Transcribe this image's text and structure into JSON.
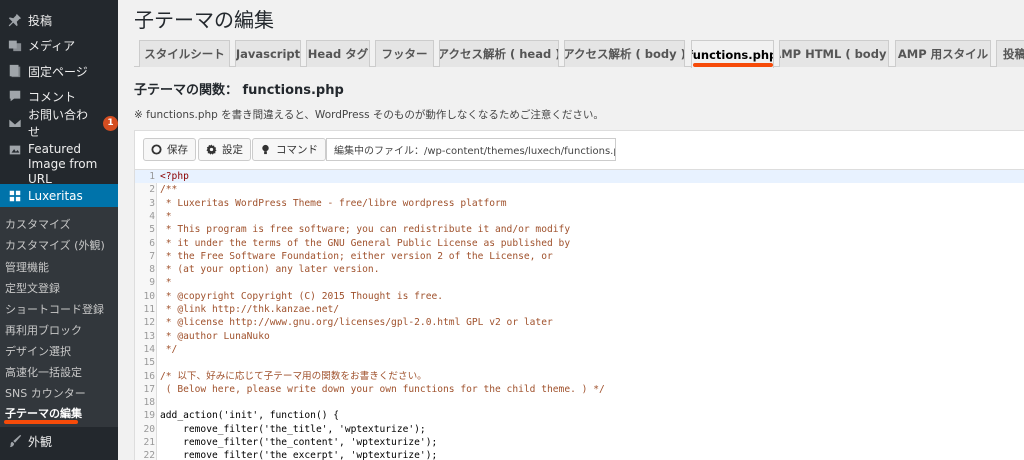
{
  "sidebar": {
    "items": [
      {
        "label": "投稿",
        "icon": "pin-icon"
      },
      {
        "label": "メディア",
        "icon": "media-icon"
      },
      {
        "label": "固定ページ",
        "icon": "page-icon"
      },
      {
        "label": "コメント",
        "icon": "comment-icon"
      },
      {
        "label": "お問い合わせ",
        "icon": "mail-icon",
        "badge": "1"
      },
      {
        "label": "Featured Image from URL",
        "icon": "image-icon"
      },
      {
        "label": "Luxeritas",
        "icon": "theme-icon",
        "active": true
      },
      {
        "label": "外観",
        "icon": "brush-icon"
      }
    ],
    "submenu": [
      "カスタマイズ",
      "カスタマイズ (外観)",
      "管理機能",
      "定型文登録",
      "ショートコード登録",
      "再利用ブロック",
      "デザイン選択",
      "高速化一括設定",
      "SNS カウンター",
      "子テーマの編集"
    ],
    "current_submenu_index": 9
  },
  "page": {
    "title": "子テーマの編集",
    "tabs": [
      "スタイルシート",
      "Javascript",
      "Head タグ",
      "フッター",
      "アクセス解析 ( head )",
      "アクセス解析 ( body )",
      "functions.php",
      "AMP HTML ( body )",
      "AMP 用スタイル",
      "投稿"
    ],
    "active_tab_index": 6,
    "section_title": "子テーマの関数： functions.php",
    "notice": "※ functions.php を書き間違えると、WordPress そのものが動作しなくなるためご注意ください。"
  },
  "toolbar": {
    "save_label": "保存",
    "settings_label": "設定",
    "command_label": "コマンド",
    "file_path": "編集中のファイル：/wp-content/themes/luxech/functions.php"
  },
  "code": {
    "lines": [
      {
        "n": "1",
        "t": "<?php",
        "k": "php"
      },
      {
        "n": "2",
        "t": "/**",
        "k": "comment"
      },
      {
        "n": "3",
        "t": " * Luxeritas WordPress Theme - free/libre wordpress platform",
        "k": "comment"
      },
      {
        "n": "4",
        "t": " *",
        "k": "comment"
      },
      {
        "n": "5",
        "t": " * This program is free software; you can redistribute it and/or modify",
        "k": "comment"
      },
      {
        "n": "6",
        "t": " * it under the terms of the GNU General Public License as published by",
        "k": "comment"
      },
      {
        "n": "7",
        "t": " * the Free Software Foundation; either version 2 of the License, or",
        "k": "comment"
      },
      {
        "n": "8",
        "t": " * (at your option) any later version.",
        "k": "comment"
      },
      {
        "n": "9",
        "t": " *",
        "k": "comment"
      },
      {
        "n": "10",
        "t": " * @copyright Copyright (C) 2015 Thought is free.",
        "k": "comment"
      },
      {
        "n": "11",
        "t": " * @link http://thk.kanzae.net/",
        "k": "comment"
      },
      {
        "n": "12",
        "t": " * @license http://www.gnu.org/licenses/gpl-2.0.html GPL v2 or later",
        "k": "comment"
      },
      {
        "n": "13",
        "t": " * @author LunaNuko",
        "k": "comment"
      },
      {
        "n": "14",
        "t": " */",
        "k": "comment"
      },
      {
        "n": "15",
        "t": "",
        "k": "code"
      },
      {
        "n": "16",
        "t": "/* 以下、好みに応じて子テーマ用の関数をお書きください。",
        "k": "comment"
      },
      {
        "n": "17",
        "t": " ( Below here, please write down your own functions for the child theme. ) */",
        "k": "comment"
      },
      {
        "n": "18",
        "t": "",
        "k": "code"
      },
      {
        "n": "19",
        "t": "add_action('init', function() {",
        "k": "code"
      },
      {
        "n": "20",
        "t": "    remove_filter('the_title', 'wptexturize');",
        "k": "code"
      },
      {
        "n": "21",
        "t": "    remove_filter('the_content', 'wptexturize');",
        "k": "code"
      },
      {
        "n": "22",
        "t": "    remove_filter('the_excerpt', 'wptexturize');",
        "k": "code"
      }
    ]
  },
  "colors": {
    "sidebar_bg": "#23282d",
    "submenu_bg": "#32373c",
    "active_bg": "#0073aa",
    "highlight_underline": "#f64b09",
    "badge_bg": "#d54e21"
  }
}
